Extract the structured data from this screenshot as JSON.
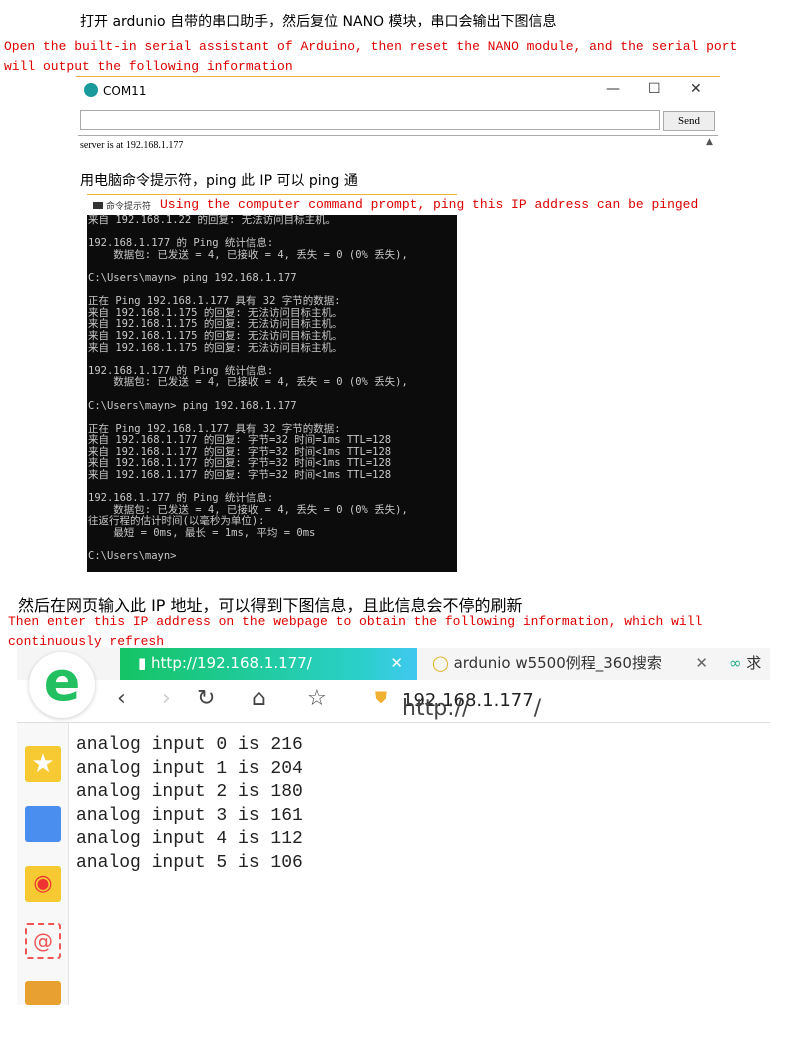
{
  "section1": {
    "heading_zh": "打开 ardunio 自带的串口助手，然后复位 NANO 模块，串口会输出下图信息",
    "heading_en": "Open the built-in serial assistant of Arduino, then reset the NANO module, and the serial port will output the following information"
  },
  "serial": {
    "title": "COM11",
    "send_label": "Send",
    "input_value": "",
    "output": "server is at 192.168.1.177",
    "minimize": "—",
    "maximize": "☐",
    "close": "✕"
  },
  "section2": {
    "heading_zh": "用电脑命令提示符，ping 此 IP 可以 ping 通",
    "heading_en": "Using the computer command prompt, ping this IP address can be pinged"
  },
  "terminal": {
    "title": "命令提示符",
    "text": "来自 192.168.1.22 的回复: 无法访问目标主机。\n\n192.168.1.177 的 Ping 统计信息:\n    数据包: 已发送 = 4, 已接收 = 4, 丢失 = 0 (0% 丢失),\n\nC:\\Users\\mayn> ping 192.168.1.177\n\n正在 Ping 192.168.1.177 具有 32 字节的数据:\n来自 192.168.1.175 的回复: 无法访问目标主机。\n来自 192.168.1.175 的回复: 无法访问目标主机。\n来自 192.168.1.175 的回复: 无法访问目标主机。\n来自 192.168.1.175 的回复: 无法访问目标主机。\n\n192.168.1.177 的 Ping 统计信息:\n    数据包: 已发送 = 4, 已接收 = 4, 丢失 = 0 (0% 丢失),\n\nC:\\Users\\mayn> ping 192.168.1.177\n\n正在 Ping 192.168.1.177 具有 32 字节的数据:\n来自 192.168.1.177 的回复: 字节=32 时间=1ms TTL=128\n来自 192.168.1.177 的回复: 字节=32 时间<1ms TTL=128\n来自 192.168.1.177 的回复: 字节=32 时间<1ms TTL=128\n来自 192.168.1.177 的回复: 字节=32 时间<1ms TTL=128\n\n192.168.1.177 的 Ping 统计信息:\n    数据包: 已发送 = 4, 已接收 = 4, 丢失 = 0 (0% 丢失),\n往返行程的估计时间(以毫秒为单位):\n    最短 = 0ms, 最长 = 1ms, 平均 = 0ms\n\nC:\\Users\\mayn>"
  },
  "section3": {
    "heading_zh": "然后在网页输入此 IP 地址，可以得到下图信息，且此信息会不停的刷新",
    "heading_en": "Then enter this IP address on the webpage to obtain the following information, which will continuously refresh"
  },
  "browser": {
    "tabs": [
      {
        "label": "http://192.168.1.177/",
        "active": true
      },
      {
        "label": "ardunio w5500例程_360搜索",
        "active": false
      },
      {
        "label": "求",
        "active": false
      }
    ],
    "url_prefix": "http://",
    "url_host": "192.168.1.177",
    "url_suffix": "/",
    "lines": [
      "analog input 0 is 216",
      "analog input 1 is 204",
      "analog input 2 is 180",
      "analog input 3 is 161",
      "analog input 4 is 112",
      "analog input 5 is 106"
    ],
    "sidebar_icons": [
      "star-icon",
      "news-icon",
      "weibo-icon",
      "mail-icon",
      "bookmark-icon"
    ],
    "accent": "#14c464"
  }
}
